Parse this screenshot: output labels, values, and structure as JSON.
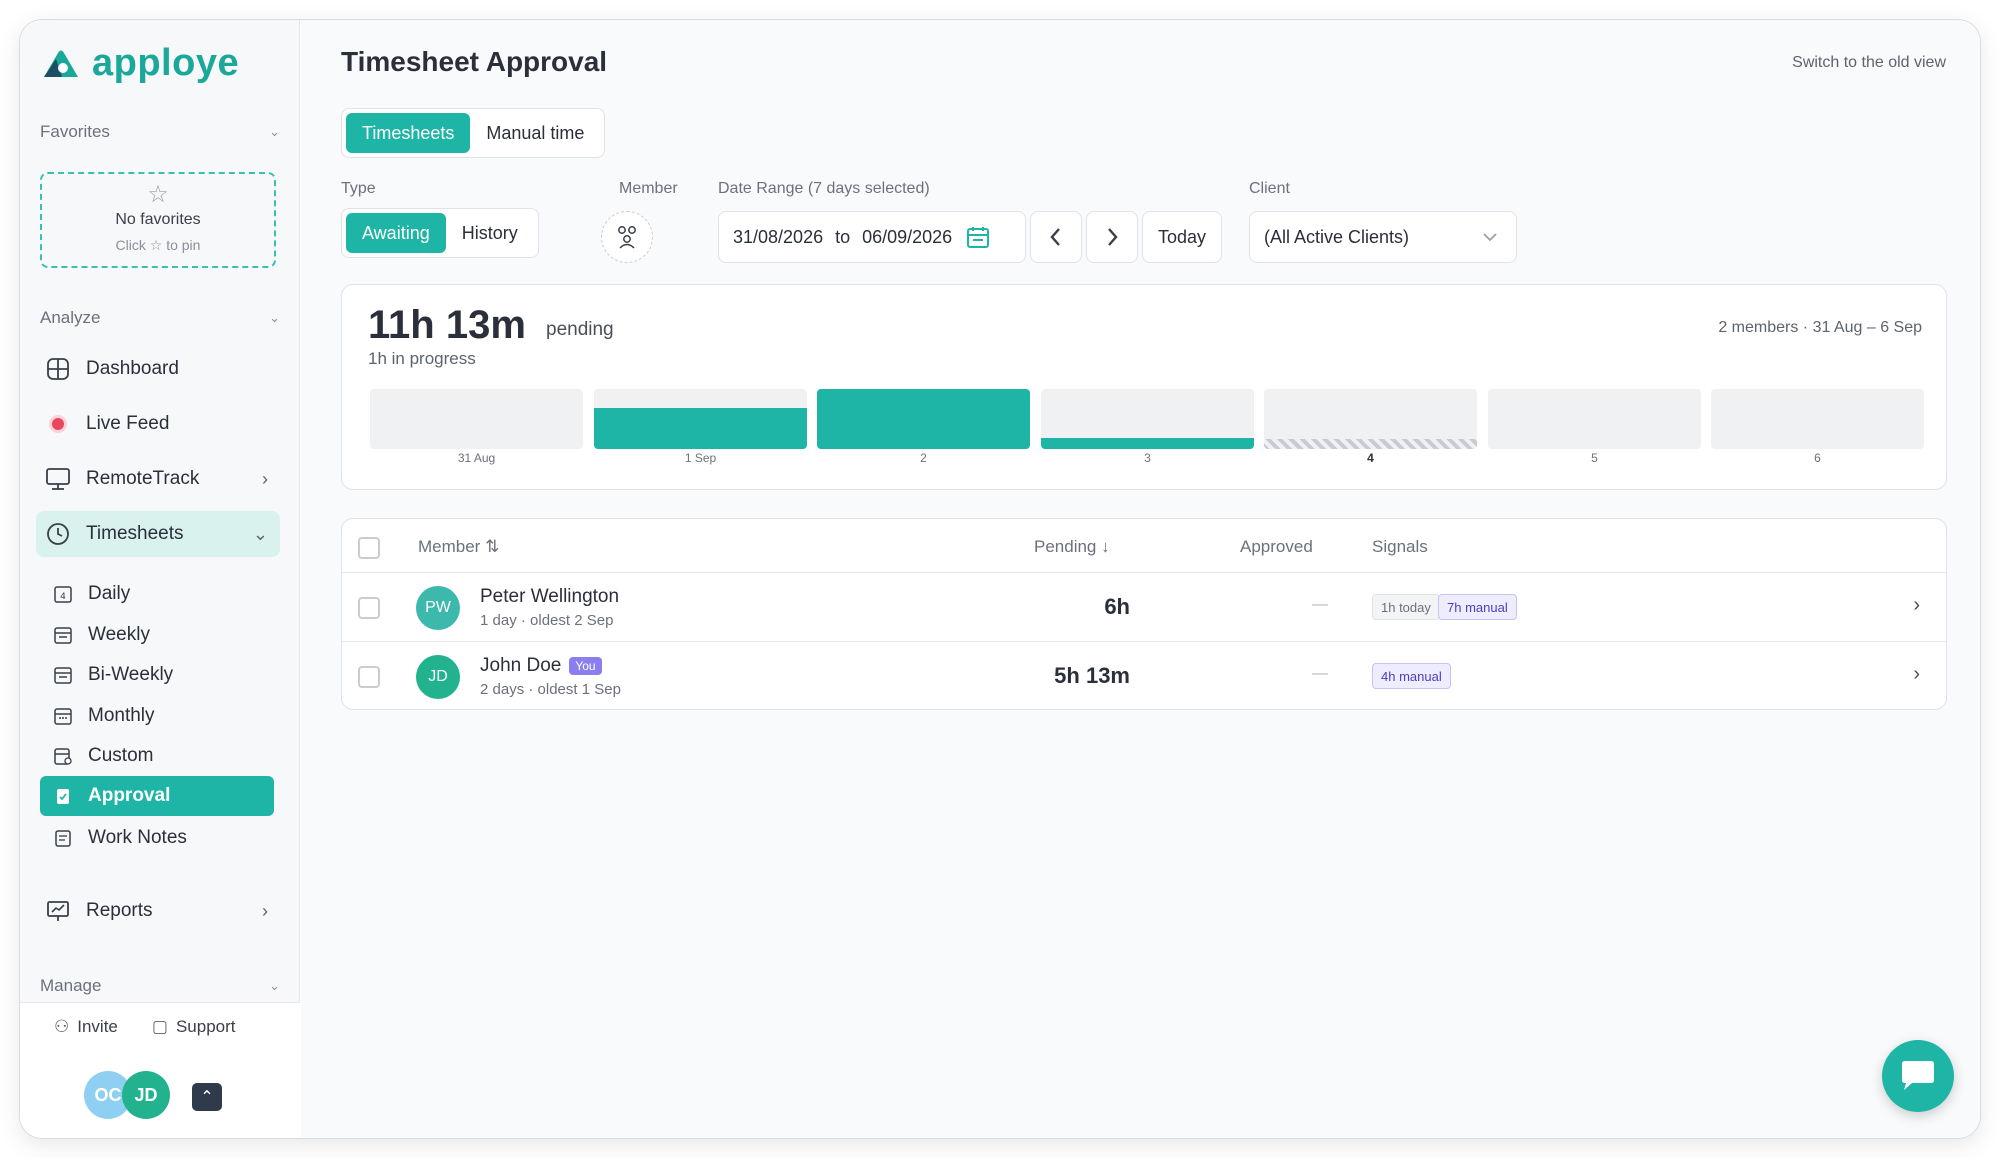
{
  "app": {
    "brand": "apploye",
    "accent": "#1fb5a6"
  },
  "sidebar": {
    "favorites": {
      "heading": "Favorites",
      "empty_title": "No favorites",
      "empty_hint": "Click ☆ to pin"
    },
    "analyze": {
      "heading": "Analyze",
      "items": [
        {
          "label": "Dashboard",
          "icon": "grid-icon"
        },
        {
          "label": "Live Feed",
          "icon": "live-dot-icon"
        },
        {
          "label": "RemoteTrack",
          "icon": "monitor-icon"
        },
        {
          "label": "Timesheets",
          "icon": "clock-icon"
        }
      ],
      "timesheet_subitems": [
        {
          "label": "Daily",
          "icon": "calendar-day-icon"
        },
        {
          "label": "Weekly",
          "icon": "calendar-icon"
        },
        {
          "label": "Bi-Weekly",
          "icon": "calendar-icon"
        },
        {
          "label": "Monthly",
          "icon": "calendar-icon"
        },
        {
          "label": "Custom",
          "icon": "calendar-edit-icon"
        },
        {
          "label": "Approval",
          "icon": "clipboard-check-icon",
          "active": true
        },
        {
          "label": "Work Notes",
          "icon": "notes-icon"
        }
      ],
      "reports": {
        "label": "Reports",
        "icon": "chart-board-icon"
      }
    },
    "manage": {
      "heading": "Manage"
    },
    "footer": {
      "invite": "Invite",
      "support": "Support",
      "avatars": [
        "OC",
        "JD"
      ]
    }
  },
  "header": {
    "title": "Timesheet Approval",
    "old_view_link": "Switch to the old view"
  },
  "tabs": [
    {
      "label": "Timesheets",
      "active": true
    },
    {
      "label": "Manual time",
      "active": false
    }
  ],
  "filters": {
    "type_label": "Type",
    "type_options": [
      {
        "label": "Awaiting",
        "active": true
      },
      {
        "label": "History",
        "active": false
      }
    ],
    "member_label": "Member",
    "date_label": "Date Range (7 days selected)",
    "date_from": "31/08/2026",
    "date_sep": "to",
    "date_to": "06/09/2026",
    "today_button": "Today",
    "client_label": "Client",
    "client_value": "(All Active Clients)"
  },
  "summary": {
    "total": "11h 13m",
    "total_suffix": "pending",
    "in_progress": "1h in progress",
    "meta": "2 members · 31 Aug – 6 Sep",
    "days": [
      {
        "label": "31 Aug",
        "fill": 0
      },
      {
        "label": "1 Sep",
        "fill": 0.68
      },
      {
        "label": "2",
        "fill": 1.0
      },
      {
        "label": "3",
        "fill": 0.18
      },
      {
        "label": "4",
        "fill": 0,
        "in_progress": true,
        "bold": true
      },
      {
        "label": "5",
        "fill": 0
      },
      {
        "label": "6",
        "fill": 0
      }
    ]
  },
  "table": {
    "headers": {
      "member": "Member",
      "member_sort": "⇅",
      "pending": "Pending",
      "pending_sort": "↓",
      "approved": "Approved",
      "signals": "Signals"
    },
    "rows": [
      {
        "initials": "PW",
        "avatar_color": "#3cb8ad",
        "name": "Peter Wellington",
        "you": "",
        "sub": "1 day · oldest 2 Sep",
        "pending": "6h",
        "approved": "—",
        "tags": [
          {
            "text": "1h today",
            "style": "gray"
          },
          {
            "text": "7h manual",
            "style": "purple"
          }
        ]
      },
      {
        "initials": "JD",
        "avatar_color": "#22b38e",
        "name": "John Doe",
        "you": "You",
        "sub": "2 days · oldest 1 Sep",
        "pending": "5h 13m",
        "approved": "—",
        "tags": [
          {
            "text": "4h manual",
            "style": "purple"
          }
        ]
      }
    ]
  }
}
